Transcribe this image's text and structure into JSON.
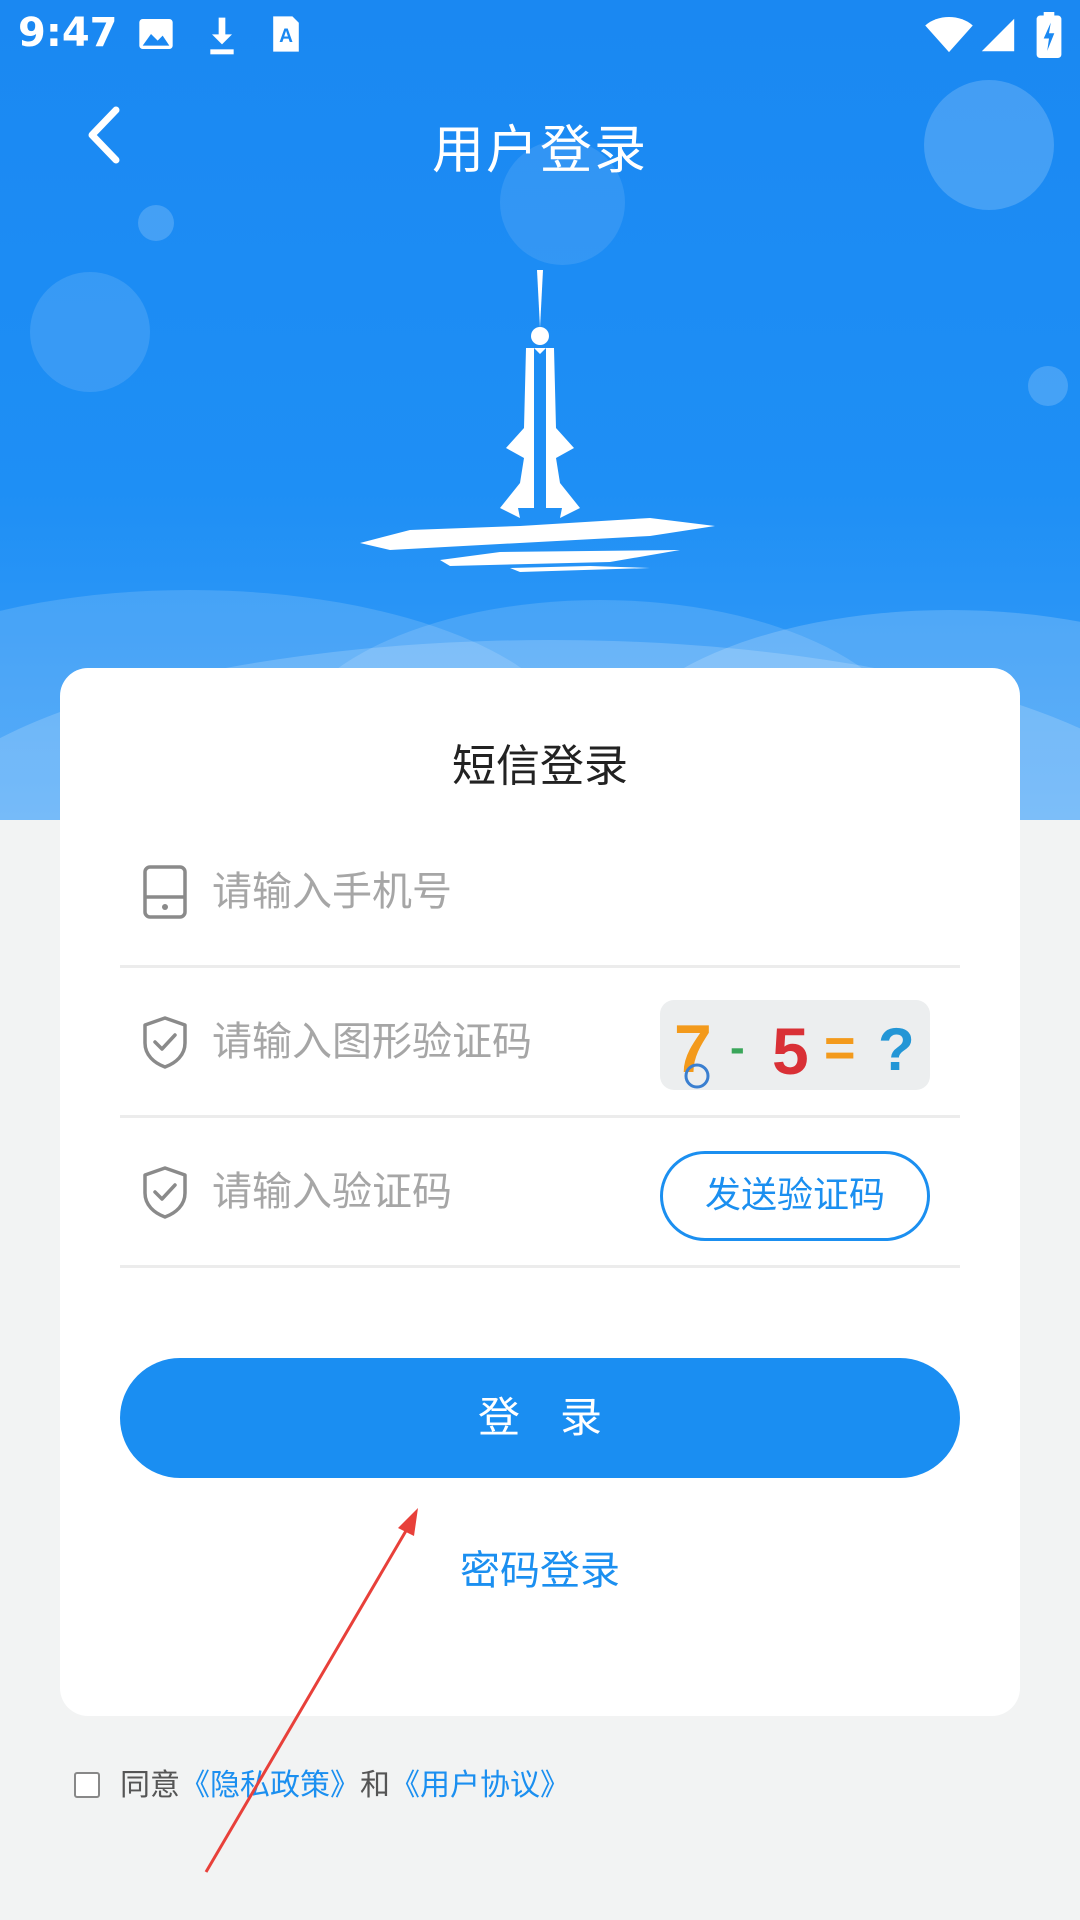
{
  "status_bar": {
    "time": "9:47",
    "icons": [
      "image-icon",
      "download-icon",
      "a-letter-icon",
      "wifi-icon",
      "signal-icon",
      "battery-charging-icon"
    ]
  },
  "header": {
    "title": "用户登录",
    "back_icon": "chevron-left-icon",
    "bg_color": "#1a88f2"
  },
  "card": {
    "title": "短信登录",
    "phone": {
      "placeholder": "请输入手机号",
      "value": "",
      "icon": "phone-icon"
    },
    "captcha": {
      "placeholder": "请输入图形验证码",
      "value": "",
      "icon": "shield-check-icon",
      "image_text": [
        "7",
        "-",
        "5",
        "=",
        "?"
      ]
    },
    "sms_code": {
      "placeholder": "请输入验证码",
      "value": "",
      "icon": "shield-check-icon",
      "send_label": "发送验证码"
    },
    "login_label": "登录",
    "password_login_label": "密码登录"
  },
  "agreement": {
    "prefix": "同意",
    "privacy_link": "《隐私政策》",
    "joiner": "和",
    "user_agreement_link": "《用户协议》",
    "checked": false
  },
  "colors": {
    "primary": "#1a8ef2",
    "annotation": "#e8403a"
  }
}
